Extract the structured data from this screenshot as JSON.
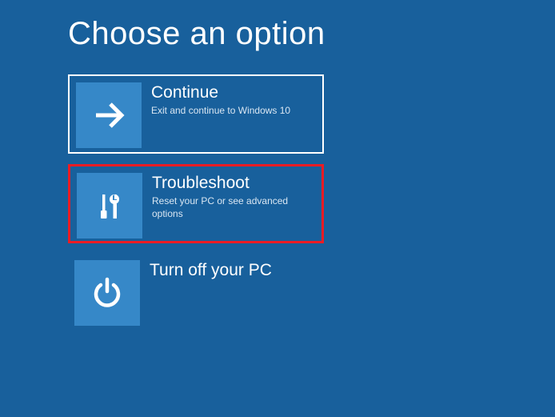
{
  "heading": "Choose an option",
  "options": [
    {
      "title": "Continue",
      "subtitle": "Exit and continue to Windows 10"
    },
    {
      "title": "Troubleshoot",
      "subtitle": "Reset your PC or see advanced options"
    },
    {
      "title": "Turn off your PC",
      "subtitle": ""
    }
  ]
}
